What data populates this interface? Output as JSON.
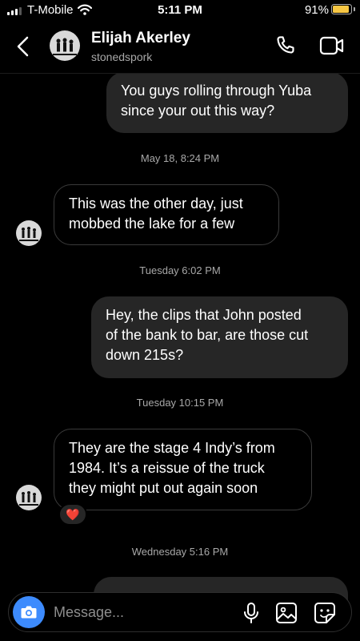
{
  "status_bar": {
    "carrier": "T-Mobile",
    "time": "5:11 PM",
    "battery": "91%",
    "battery_level": 0.91
  },
  "header": {
    "name": "Elijah Akerley",
    "handle": "stonedspork"
  },
  "messages": [
    {
      "direction": "out",
      "text": "You guys rolling through Yuba\nsince your out this way?"
    },
    {
      "timestamp": "May 18, 8:24 PM"
    },
    {
      "direction": "in",
      "text": "This was the other day, just\nmobbed the lake for a few"
    },
    {
      "timestamp": "Tuesday 6:02 PM"
    },
    {
      "direction": "out",
      "text": "Hey, the clips that John posted\nof the bank to bar, are those cut\ndown 215s?"
    },
    {
      "timestamp": "Tuesday 10:15 PM"
    },
    {
      "direction": "in",
      "text": "They are the stage 4 Indy’s from\n1984. It’s a reissue of the truck\nthey might put out again soon",
      "reaction": "❤️"
    },
    {
      "timestamp": "Wednesday 5:16 PM"
    }
  ],
  "composer": {
    "placeholder": "Message..."
  },
  "colors": {
    "accent": "#3d8bfd",
    "outgoing_bubble": "#262626",
    "battery": "#f7c744"
  }
}
